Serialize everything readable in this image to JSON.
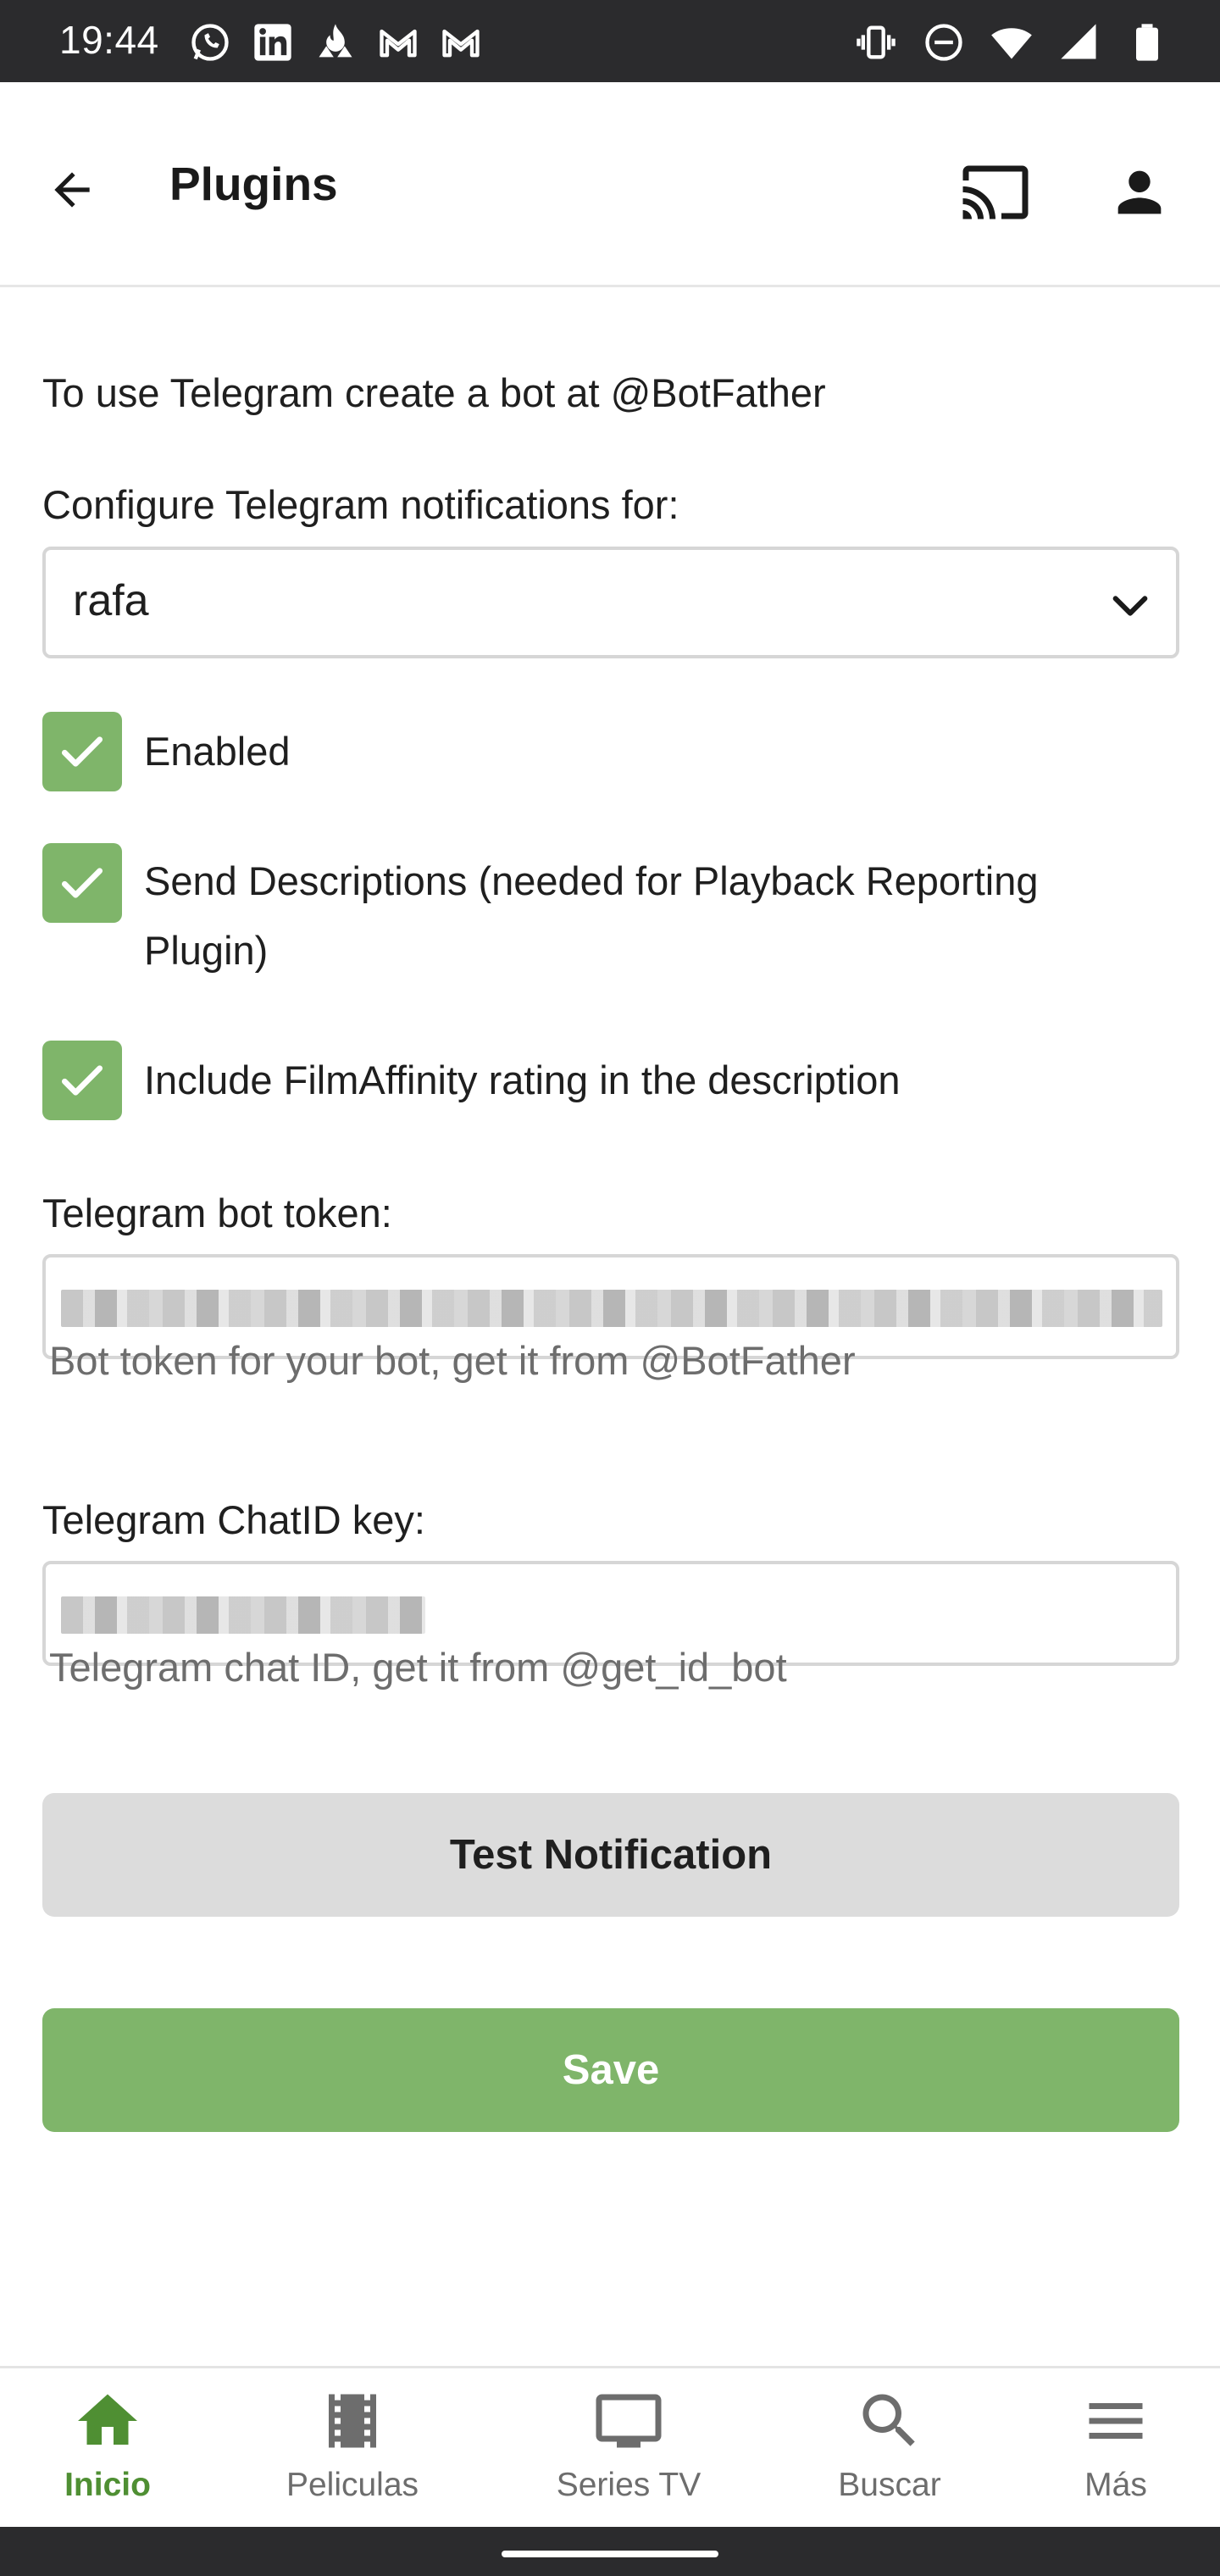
{
  "status_bar": {
    "time": "19:44",
    "left_icons": [
      "whatsapp-icon",
      "linkedin-icon",
      "fire-icon",
      "gmail-icon",
      "gmail-icon"
    ],
    "right_icons": [
      "vibrate-icon",
      "do-not-disturb-icon",
      "wifi-icon",
      "signal-icon",
      "battery-icon"
    ]
  },
  "header": {
    "title": "Plugins",
    "back_icon": "arrow-left-icon",
    "cast_icon": "cast-icon",
    "user_icon": "person-icon"
  },
  "form": {
    "intro": "To use Telegram create a bot at @BotFather",
    "configure_label": "Configure Telegram notifications for:",
    "user_select": {
      "value": "rafa"
    },
    "checkboxes": [
      {
        "label": "Enabled",
        "checked": true
      },
      {
        "label": "Send Descriptions (needed for Playback Reporting Plugin)",
        "checked": true
      },
      {
        "label": "Include FilmAffinity rating in the description",
        "checked": true
      }
    ],
    "bot_token": {
      "label": "Telegram bot token:",
      "help": "Bot token for your bot, get it from @BotFather"
    },
    "chat_id": {
      "label": "Telegram ChatID key:",
      "help": "Telegram chat ID, get it from @get_id_bot"
    },
    "test_button": "Test Notification",
    "save_button": "Save"
  },
  "bottom_nav": {
    "items": [
      {
        "label": "Inicio",
        "icon": "home-icon",
        "active": true
      },
      {
        "label": "Peliculas",
        "icon": "film-icon",
        "active": false
      },
      {
        "label": "Series TV",
        "icon": "tv-icon",
        "active": false
      },
      {
        "label": "Buscar",
        "icon": "search-icon",
        "active": false
      },
      {
        "label": "Más",
        "icon": "menu-icon",
        "active": false
      }
    ]
  },
  "colors": {
    "accent_green": "#7fb56a",
    "active_nav": "#4f8f33",
    "status_bar": "#2b2b2d"
  }
}
